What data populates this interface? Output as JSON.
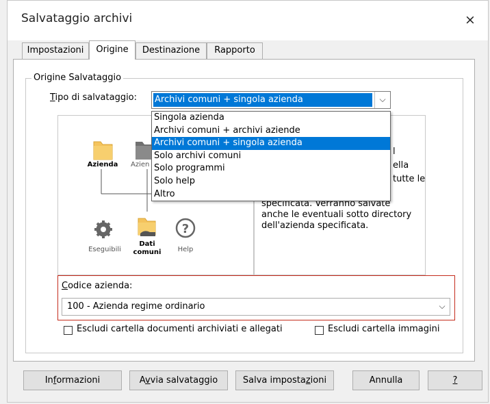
{
  "window": {
    "title": "Salvataggio archivi",
    "close_glyph": "×"
  },
  "tabs": [
    {
      "label": "Impostazioni",
      "active": false
    },
    {
      "label": "Origine",
      "active": true
    },
    {
      "label": "Destinazione",
      "active": false
    },
    {
      "label": "Rapporto",
      "active": false
    }
  ],
  "origine": {
    "group_label": "Origine Salvataggio",
    "tipo_label_mnemonic": "T",
    "tipo_label_rest": "ipo di salvataggio:",
    "tipo_value": "Archivi comuni + singola azienda",
    "dropdown_options": [
      "Singola azienda",
      "Archivi comuni + archivi aziende",
      "Archivi comuni + singola azienda",
      "Solo archivi comuni",
      "Solo programmi",
      "Solo help",
      "Altro"
    ],
    "dropdown_selected_index": 2,
    "diagram": {
      "azienda": "Azienda",
      "azienda2": "Azien",
      "eseguibili": "Eseguibili",
      "dati_line1": "Dati",
      "dati_line2": "comuni",
      "help": "Help"
    },
    "description_visible": {
      "frag1": "l",
      "frag2": "ella",
      "frag3": "tutte le",
      "line4": "specificata. Verranno salvate",
      "line5": "anche le eventuali sotto directory",
      "line6": "dell'azienda specificata."
    },
    "codice_label_mnemonic": "C",
    "codice_label_rest": "odice azienda:",
    "codice_value": "100 - Azienda regime ordinario",
    "checkbox_docs": "Escludi cartella documenti archiviati e allegati",
    "checkbox_images": "Escludi cartella immagini",
    "checkbox_docs_checked": false,
    "checkbox_images_checked": false
  },
  "buttons": {
    "informazioni_a": "In",
    "informazioni_m": "f",
    "informazioni_b": "ormazioni",
    "avvia_a": "A",
    "avvia_m": "v",
    "avvia_b": "via salvataggio",
    "salva_a": "Salva imposta",
    "salva_m": "z",
    "salva_b": "ioni",
    "annulla": "Annulla",
    "help": "?"
  },
  "colors": {
    "accent": "#0078d7",
    "highlight_box": "#c42b1c",
    "folder": "#f4c35c"
  }
}
